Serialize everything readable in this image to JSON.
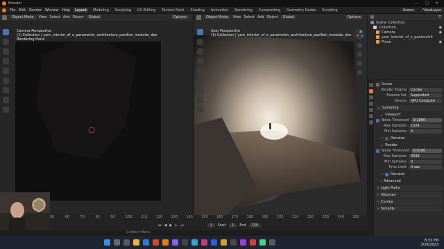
{
  "window": {
    "title": "Blender"
  },
  "menubar": {
    "mode_menu": [
      "File",
      "Edit",
      "Render",
      "Window",
      "Help"
    ],
    "workspaces": [
      "Layout",
      "Modeling",
      "Sculpting",
      "UV Editing",
      "Texture Paint",
      "Shading",
      "Animation",
      "Rendering",
      "Compositing",
      "Geometry Nodes",
      "Scripting"
    ],
    "active_workspace": "Layout",
    "scene": "Scene",
    "view_layer": "ViewLayer"
  },
  "left_viewport": {
    "mode": "Object Mode",
    "menus": [
      "View",
      "Select",
      "Add",
      "Object"
    ],
    "transform": "Global",
    "options": "Options",
    "label_line1": "Camera Perspective",
    "label_line2": "(1) Collection | yarn_interior_of_a_parametric_architecture_pavilion_modular_des",
    "label_line3": "Rendering Done"
  },
  "right_viewport": {
    "mode": "Object Mode",
    "menus": [
      "View",
      "Select",
      "Add",
      "Object"
    ],
    "transform": "Global",
    "options": "Options",
    "label_line1": "User Perspective",
    "label_line2": "(1) Collection | yarn_interior_of_a_parametric_architecture_pavilion_modular_des"
  },
  "outliner": {
    "header": "Scene Collection",
    "items": [
      {
        "label": "Collection",
        "depth": 1
      },
      {
        "label": "Camera",
        "depth": 2
      },
      {
        "label": "yarn_interior_of_a_parametrit",
        "depth": 2
      },
      {
        "label": "Plane",
        "depth": 2
      }
    ]
  },
  "properties": {
    "scene_label": "Scene",
    "render_engine_label": "Render Engine",
    "render_engine": "Cycles",
    "feature_set_label": "Feature Set",
    "feature_set": "Supported",
    "device_label": "Device",
    "device": "GPU Compute",
    "sampling": "Sampling",
    "viewport": "Viewport",
    "noise_threshold_label": "Noise Threshold",
    "viewport_noise_threshold": "0.1000",
    "max_samples_label": "Max Samples",
    "viewport_max_samples": "1024",
    "min_samples_label": "Min Samples",
    "viewport_min_samples": "0",
    "denoise": "Denoise",
    "render": "Render",
    "render_noise_threshold": "0.0100",
    "render_max_samples": "4096",
    "render_min_samples": "0",
    "time_limit_label": "Time Limit",
    "time_limit": "0 sec",
    "render_denoise": "Denoise",
    "advanced": "Advanced",
    "light_paths": "Light Paths",
    "volumes": "Volumes",
    "curves": "Curves",
    "simplify": "Simplify"
  },
  "timeline": {
    "ticks": [
      "50",
      "60",
      "70",
      "80",
      "90",
      "100",
      "110",
      "120",
      "130",
      "140",
      "150",
      "160",
      "170",
      "180",
      "190",
      "200",
      "210",
      "220",
      "230",
      "240",
      "250"
    ],
    "current_frame": "1",
    "start_label": "Start",
    "start": "1",
    "end_label": "End",
    "end": "250"
  },
  "status": {
    "text": "Context Menu"
  },
  "taskbar": {
    "time": "8:33 PM",
    "date": "3/29/2023"
  }
}
